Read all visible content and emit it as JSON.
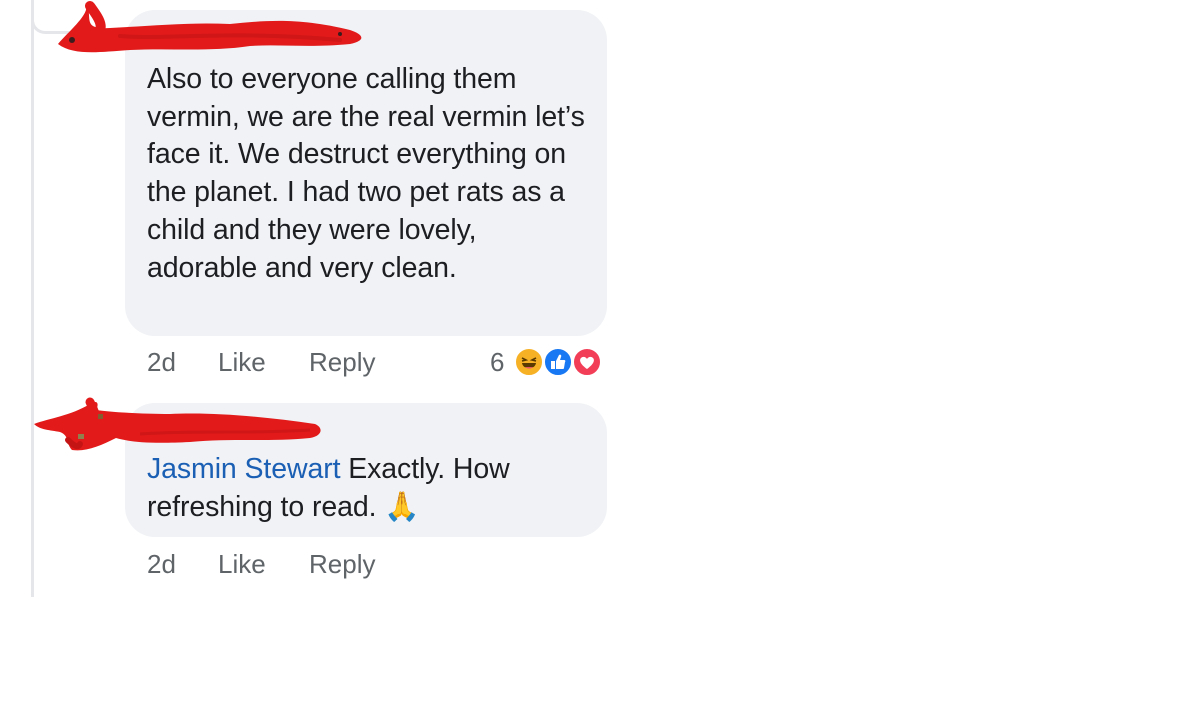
{
  "comments": [
    {
      "text": "Also to everyone calling them vermin, we are the real vermin let’s face it. We destruct everything on the planet. I had two pet rats as a child and they were lovely, adorable and very clean.",
      "time": "2d",
      "like_label": "Like",
      "reply_label": "Reply",
      "reaction_count": "6",
      "reactions": [
        "haha-icon",
        "like-icon",
        "love-icon"
      ]
    },
    {
      "mention": "Jasmin Stewart",
      "text": " Exactly. How refreshing to read. 🙏",
      "time": "2d",
      "like_label": "Like",
      "reply_label": "Reply"
    }
  ],
  "colors": {
    "bubble": "#f0f2f5",
    "text": "#1c1e21",
    "meta": "#5f6469",
    "mention": "#1a5fb4",
    "redaction": "#e21a1a",
    "like_reaction": "#1877f2",
    "love_reaction": "#f33e58",
    "haha_reaction": "#f7b125"
  }
}
